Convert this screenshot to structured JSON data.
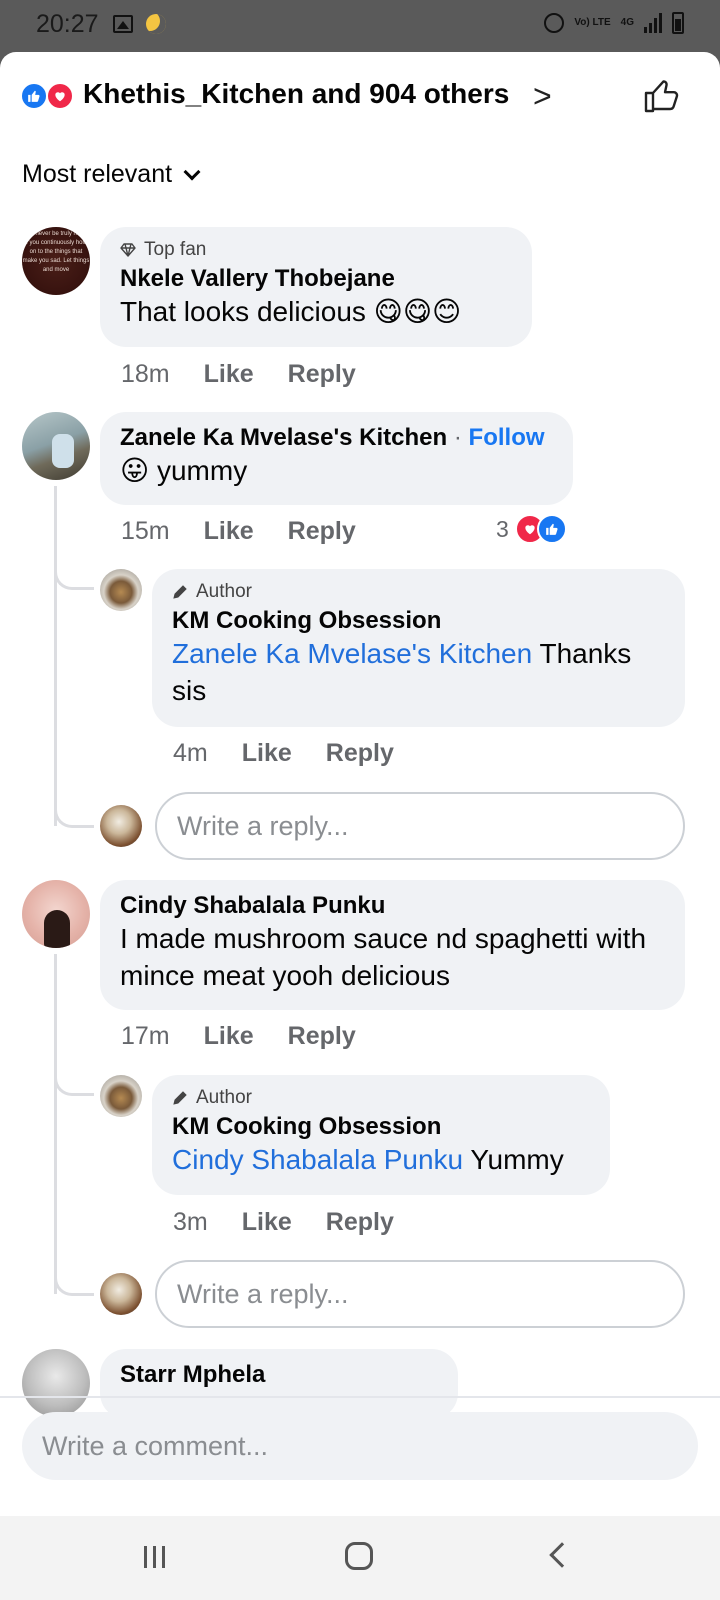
{
  "status_bar": {
    "time": "20:27",
    "network": "4G",
    "volte": "Vo) LTE"
  },
  "reactions_header": {
    "summary": "Khethis_Kitchen and 904 others",
    "chevron": ">"
  },
  "sort": {
    "label": "Most relevant"
  },
  "comments": [
    {
      "badge": "Top fan",
      "name": "Nkele Vallery Thobejane",
      "text": "That looks delicious 😋😋😊",
      "time": "18m",
      "like": "Like",
      "reply": "Reply",
      "avatar_text": "I will never be truly happy if you continuously hold on to the things that make you sad. Let things and move"
    },
    {
      "name": "Zanele Ka Mvelase's Kitchen",
      "follow": "Follow",
      "text": "😛 yummy",
      "time": "15m",
      "like": "Like",
      "reply": "Reply",
      "reaction_count": "3",
      "replies": [
        {
          "badge": "Author",
          "name": "KM Cooking Obsession",
          "mention": "Zanele Ka Mvelase's Kitchen",
          "text": "Thanks sis",
          "time": "4m",
          "like": "Like",
          "reply": "Reply"
        }
      ],
      "reply_placeholder": "Write a reply..."
    },
    {
      "name": "Cindy Shabalala Punku",
      "text": "I made mushroom sauce nd spaghetti with mince meat yooh delicious",
      "time": "17m",
      "like": "Like",
      "reply": "Reply",
      "replies": [
        {
          "badge": "Author",
          "name": "KM Cooking Obsession",
          "mention": "Cindy Shabalala Punku",
          "text": "Yummy",
          "time": "3m",
          "like": "Like",
          "reply": "Reply"
        }
      ],
      "reply_placeholder": "Write a reply..."
    },
    {
      "name": "Starr Mphela"
    }
  ],
  "comment_input": {
    "placeholder": "Write a comment..."
  },
  "colors": {
    "like_blue": "#1877f2",
    "love_red": "#f02849",
    "mention_blue": "#216fdb",
    "bubble_gray": "#f0f2f5"
  },
  "icons": [
    "gallery-icon",
    "moon-icon",
    "alarm-icon",
    "signal-icon",
    "battery-icon",
    "like-reaction-icon",
    "love-reaction-icon",
    "chevron-right-icon",
    "thumbs-up-icon",
    "chevron-down-icon",
    "diamond-icon",
    "pencil-icon",
    "recent-apps-icon",
    "home-icon",
    "back-icon"
  ]
}
